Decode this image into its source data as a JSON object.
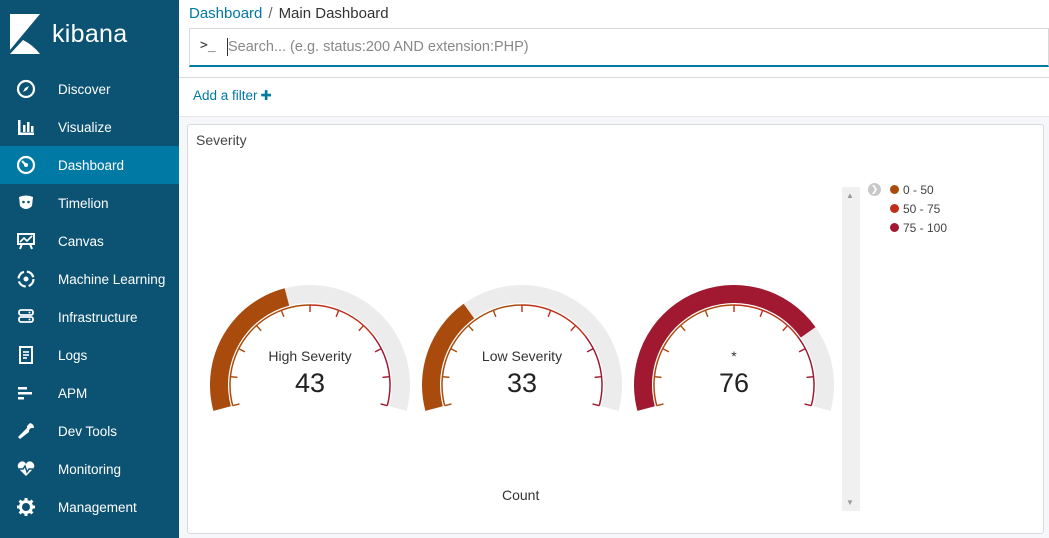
{
  "app": {
    "name": "kibana"
  },
  "sidebar": {
    "items": [
      {
        "label": "Discover",
        "icon": "compass-icon",
        "name": "discover"
      },
      {
        "label": "Visualize",
        "icon": "bar-chart-icon",
        "name": "visualize"
      },
      {
        "label": "Dashboard",
        "icon": "dashboard-icon",
        "name": "dashboard",
        "active": true
      },
      {
        "label": "Timelion",
        "icon": "timelion-icon",
        "name": "timelion"
      },
      {
        "label": "Canvas",
        "icon": "canvas-icon",
        "name": "canvas"
      },
      {
        "label": "Machine Learning",
        "icon": "machine-learning-icon",
        "name": "machine-learning"
      },
      {
        "label": "Infrastructure",
        "icon": "infrastructure-icon",
        "name": "infrastructure"
      },
      {
        "label": "Logs",
        "icon": "logs-icon",
        "name": "logs"
      },
      {
        "label": "APM",
        "icon": "apm-icon",
        "name": "apm"
      },
      {
        "label": "Dev Tools",
        "icon": "wrench-icon",
        "name": "dev-tools"
      },
      {
        "label": "Monitoring",
        "icon": "heartbeat-icon",
        "name": "monitoring"
      },
      {
        "label": "Management",
        "icon": "gear-icon",
        "name": "management"
      }
    ]
  },
  "breadcrumb": {
    "parent": "Dashboard",
    "separator": "/",
    "current": "Main Dashboard"
  },
  "search": {
    "prompt": ">_",
    "placeholder": "Search... (e.g. status:200 AND extension:PHP)",
    "value": ""
  },
  "filters": {
    "add_label": "Add a filter",
    "add_icon": "plus-icon"
  },
  "panel": {
    "title": "Severity",
    "count_label": "Count",
    "legend": [
      {
        "label": "0 - 50",
        "color": "#a84b0d"
      },
      {
        "label": "50 - 75",
        "color": "#bf2e18"
      },
      {
        "label": "75 - 100",
        "color": "#a01931"
      }
    ]
  },
  "gauges": [
    {
      "label": "High Severity",
      "value": 43,
      "value_text": "43",
      "color": "#a84b0d",
      "max": 100
    },
    {
      "label": "Low Severity",
      "value": 33,
      "value_text": "33",
      "color": "#a84b0d",
      "max": 100
    },
    {
      "label": "*",
      "value": 76,
      "value_text": "76",
      "color": "#a01931",
      "max": 100
    }
  ],
  "colors": {
    "sidebar_bg": "#0b5273",
    "sidebar_active": "#0179a5",
    "link": "#0079a5",
    "gauge_track": "#ececec",
    "range_0_50": "#a84b0d",
    "range_50_75": "#bf2e18",
    "range_75_100": "#a01931"
  }
}
